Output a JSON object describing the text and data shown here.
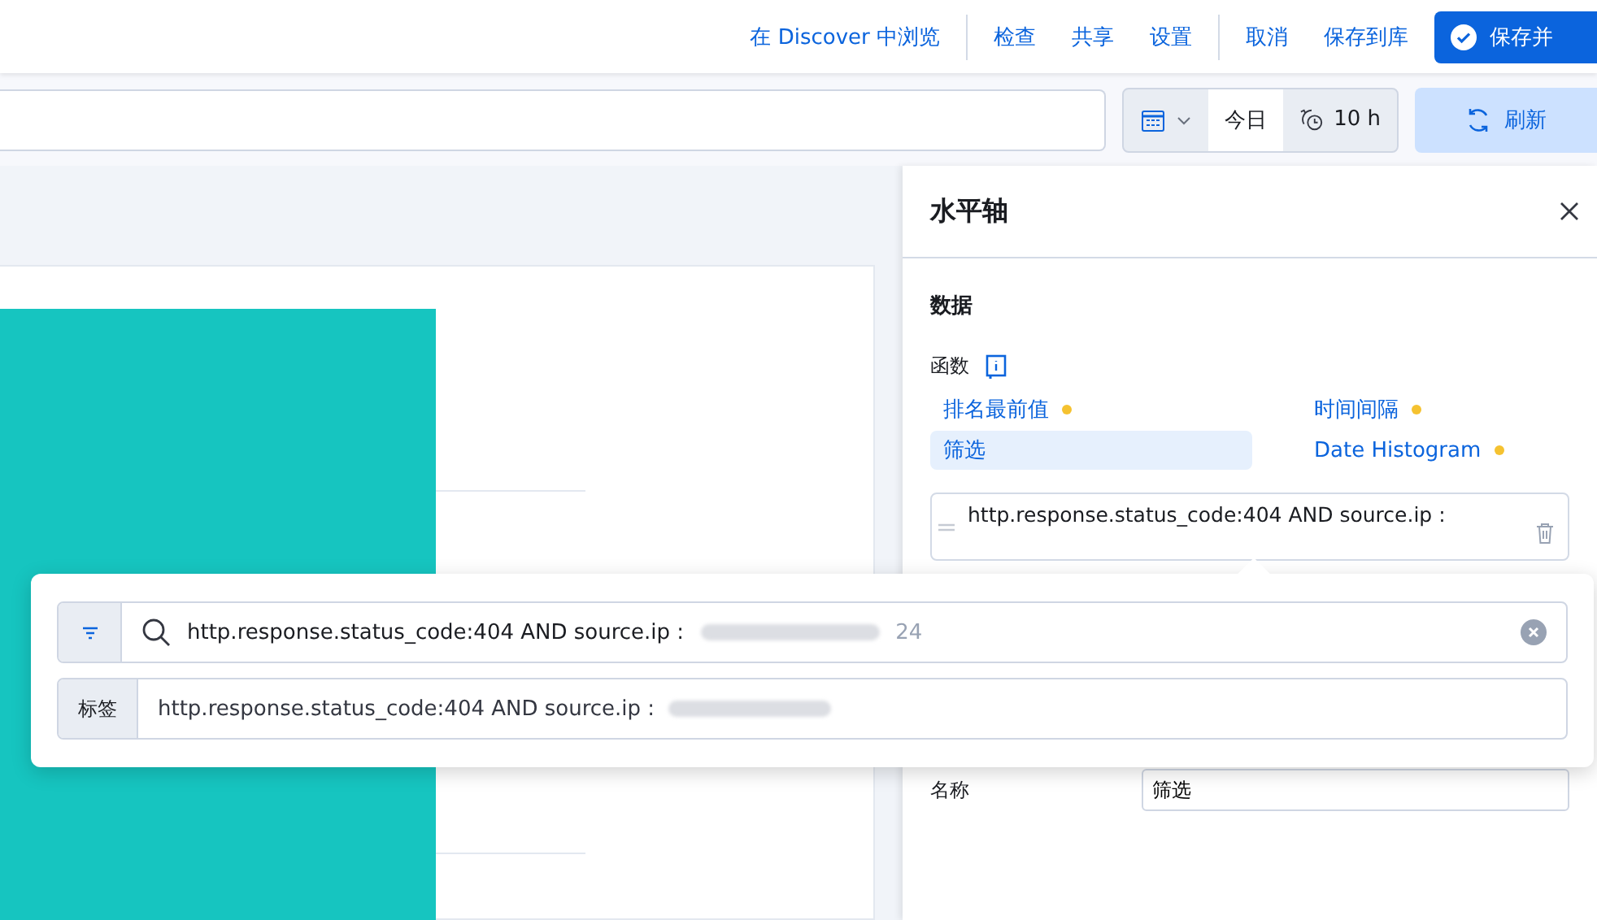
{
  "top_nav": {
    "link_groups": [
      [
        "在 Discover 中浏览"
      ],
      [
        "检查",
        "共享",
        "设置"
      ],
      [
        "取消",
        "保存到库"
      ]
    ],
    "primary_button": "保存并"
  },
  "query_bar": {
    "date_picker": {
      "range": "今日",
      "refresh_interval": "10 h"
    },
    "refresh_button": "刷新"
  },
  "flyout": {
    "title": "水平轴",
    "section": "数据",
    "function_label": "函数",
    "functions": [
      {
        "label": "排名最前值",
        "selected": false,
        "dot": true
      },
      {
        "label": "时间间隔",
        "selected": false,
        "dot": true
      },
      {
        "label": "筛选",
        "selected": true,
        "dot": false
      },
      {
        "label": "Date Histogram",
        "selected": false,
        "dot": true
      }
    ],
    "filter_item": "http.response.status_code:404 AND source.ip :",
    "name_label": "名称",
    "name_value": "筛选"
  },
  "popover": {
    "query": "http.response.status_code:404 AND source.ip :",
    "query_tail": "24",
    "label_prefix": "标签",
    "label_value": "http.response.status_code:404 AND source.ip :"
  }
}
